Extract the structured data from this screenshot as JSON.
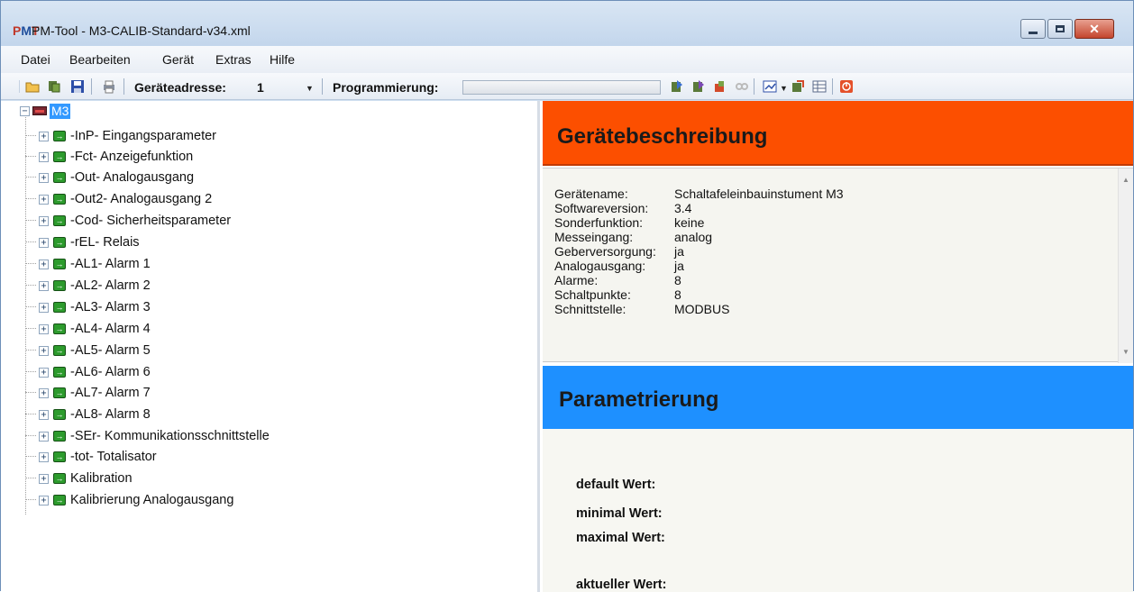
{
  "window": {
    "title": "PM-Tool - M3-CALIB-Standard-v34.xml",
    "close_glyph": "✕"
  },
  "menu": {
    "items": [
      "Datei",
      "Bearbeiten",
      "Gerät",
      "Extras",
      "Hilfe"
    ]
  },
  "toolbar": {
    "address_label": "Geräteadresse:",
    "address_value": "1",
    "programming_label": "Programmierung:",
    "programming_progress": 0
  },
  "tree": {
    "root_label": "M3",
    "items": [
      "-InP- Eingangsparameter",
      "-Fct- Anzeigefunktion",
      "-Out- Analogausgang",
      "-Out2- Analogausgang 2",
      "-Cod- Sicherheitsparameter",
      "-rEL- Relais",
      "-AL1- Alarm 1",
      "-AL2- Alarm 2",
      "-AL3- Alarm 3",
      "-AL4- Alarm 4",
      "-AL5- Alarm 5",
      "-AL6- Alarm 6",
      "-AL7- Alarm 7",
      "-AL8- Alarm 8",
      "-SEr- Kommunikationsschnittstelle",
      "-tot- Totalisator",
      "Kalibration",
      "Kalibrierung Analogausgang"
    ]
  },
  "description": {
    "title": "Gerätebeschreibung",
    "rows": [
      {
        "key": "Gerätename:",
        "value": "Schaltafeleinbauinstument M3"
      },
      {
        "key": "Softwareversion:",
        "value": "3.4"
      },
      {
        "key": "Sonderfunktion:",
        "value": "keine"
      },
      {
        "key": "Messeingang:",
        "value": "analog"
      },
      {
        "key": "Geberversorgung:",
        "value": "ja"
      },
      {
        "key": "Analogausgang:",
        "value": "ja"
      },
      {
        "key": "Alarme:",
        "value": "8"
      },
      {
        "key": "Schaltpunkte:",
        "value": "8"
      },
      {
        "key": "Schnittstelle:",
        "value": "MODBUS"
      }
    ]
  },
  "parameters": {
    "title": "Parametrierung",
    "default_label": "default Wert:",
    "min_label": "minimal Wert:",
    "max_label": "maximal Wert:",
    "current_label": "aktueller Wert:"
  },
  "colors": {
    "description_header": "#fc4f00",
    "parameter_header": "#1e90ff",
    "selection": "#3399ff"
  }
}
